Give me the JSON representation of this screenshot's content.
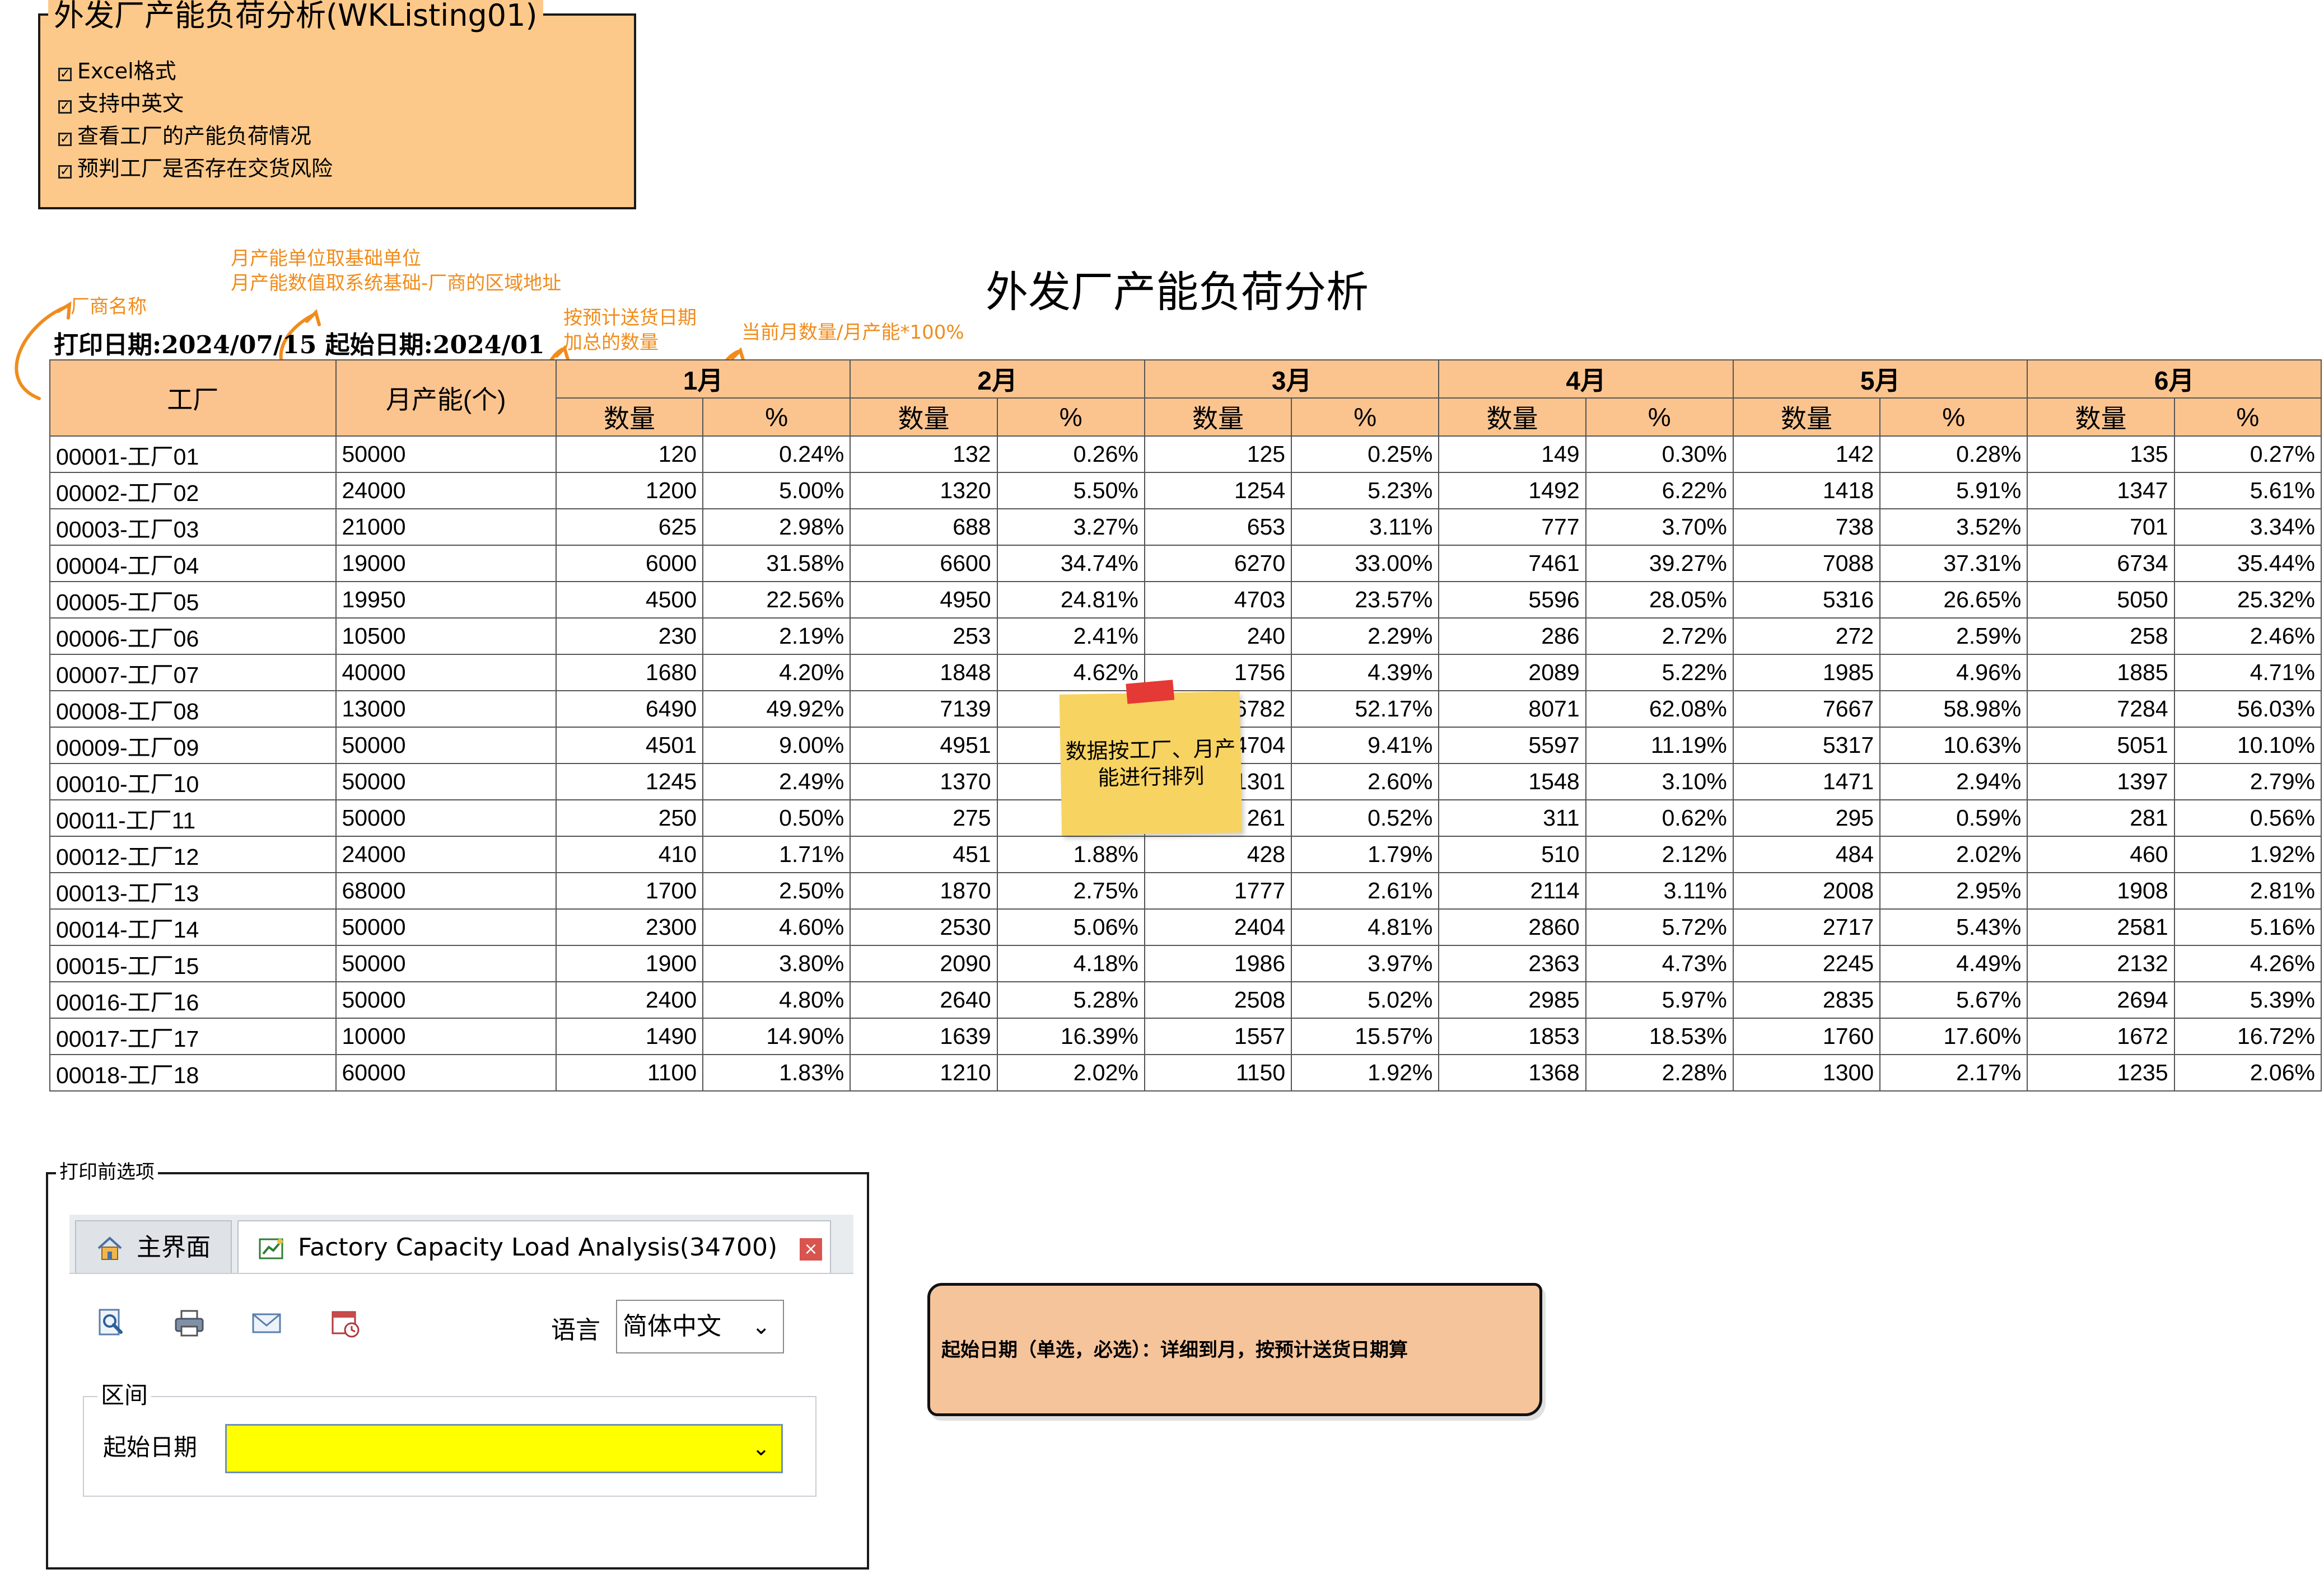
{
  "feature_box": {
    "title": "外发厂产能负荷分析(WKListing01)",
    "items": [
      "Excel格式",
      "支持中英文",
      "查看工厂的产能负荷情况",
      "预判工厂是否存在交货风险"
    ]
  },
  "annotations": {
    "vendor_name": "厂商名称",
    "capacity_unit": "月产能单位取基础单位",
    "capacity_value": "月产能数值取系统基础-厂商的区域地址",
    "qty_sum_1": "按预计送货日期",
    "qty_sum_2": "加总的数量",
    "percent_formula": "当前月数量/月产能*100%"
  },
  "report": {
    "title": "外发厂产能负荷分析",
    "print_date_label": "打印日期:",
    "print_date": "2024/07/15",
    "start_date_label": "起始日期:",
    "start_date": "2024/01"
  },
  "table": {
    "factory_header": "工厂",
    "capacity_header": "月产能(个)",
    "months": [
      "1月",
      "2月",
      "3月",
      "4月",
      "5月",
      "6月"
    ],
    "qty_header": "数量",
    "pct_header": "%",
    "rows": [
      {
        "factory": "00001-工厂01",
        "capacity": "50000",
        "cells": [
          [
            "120",
            "0.24%"
          ],
          [
            "132",
            "0.26%"
          ],
          [
            "125",
            "0.25%"
          ],
          [
            "149",
            "0.30%"
          ],
          [
            "142",
            "0.28%"
          ],
          [
            "135",
            "0.27%"
          ]
        ]
      },
      {
        "factory": "00002-工厂02",
        "capacity": "24000",
        "cells": [
          [
            "1200",
            "5.00%"
          ],
          [
            "1320",
            "5.50%"
          ],
          [
            "1254",
            "5.23%"
          ],
          [
            "1492",
            "6.22%"
          ],
          [
            "1418",
            "5.91%"
          ],
          [
            "1347",
            "5.61%"
          ]
        ]
      },
      {
        "factory": "00003-工厂03",
        "capacity": "21000",
        "cells": [
          [
            "625",
            "2.98%"
          ],
          [
            "688",
            "3.27%"
          ],
          [
            "653",
            "3.11%"
          ],
          [
            "777",
            "3.70%"
          ],
          [
            "738",
            "3.52%"
          ],
          [
            "701",
            "3.34%"
          ]
        ]
      },
      {
        "factory": "00004-工厂04",
        "capacity": "19000",
        "cells": [
          [
            "6000",
            "31.58%"
          ],
          [
            "6600",
            "34.74%"
          ],
          [
            "6270",
            "33.00%"
          ],
          [
            "7461",
            "39.27%"
          ],
          [
            "7088",
            "37.31%"
          ],
          [
            "6734",
            "35.44%"
          ]
        ]
      },
      {
        "factory": "00005-工厂05",
        "capacity": "19950",
        "cells": [
          [
            "4500",
            "22.56%"
          ],
          [
            "4950",
            "24.81%"
          ],
          [
            "4703",
            "23.57%"
          ],
          [
            "5596",
            "28.05%"
          ],
          [
            "5316",
            "26.65%"
          ],
          [
            "5050",
            "25.32%"
          ]
        ]
      },
      {
        "factory": "00006-工厂06",
        "capacity": "10500",
        "cells": [
          [
            "230",
            "2.19%"
          ],
          [
            "253",
            "2.41%"
          ],
          [
            "240",
            "2.29%"
          ],
          [
            "286",
            "2.72%"
          ],
          [
            "272",
            "2.59%"
          ],
          [
            "258",
            "2.46%"
          ]
        ]
      },
      {
        "factory": "00007-工厂07",
        "capacity": "40000",
        "cells": [
          [
            "1680",
            "4.20%"
          ],
          [
            "1848",
            "4.62%"
          ],
          [
            "1756",
            "4.39%"
          ],
          [
            "2089",
            "5.22%"
          ],
          [
            "1985",
            "4.96%"
          ],
          [
            "1885",
            "4.71%"
          ]
        ]
      },
      {
        "factory": "00008-工厂08",
        "capacity": "13000",
        "cells": [
          [
            "6490",
            "49.92%"
          ],
          [
            "7139",
            ""
          ],
          [
            "6782",
            "52.17%"
          ],
          [
            "8071",
            "62.08%"
          ],
          [
            "7667",
            "58.98%"
          ],
          [
            "7284",
            "56.03%"
          ]
        ]
      },
      {
        "factory": "00009-工厂09",
        "capacity": "50000",
        "cells": [
          [
            "4501",
            "9.00%"
          ],
          [
            "4951",
            ""
          ],
          [
            "4704",
            "9.41%"
          ],
          [
            "5597",
            "11.19%"
          ],
          [
            "5317",
            "10.63%"
          ],
          [
            "5051",
            "10.10%"
          ]
        ]
      },
      {
        "factory": "00010-工厂10",
        "capacity": "50000",
        "cells": [
          [
            "1245",
            "2.49%"
          ],
          [
            "1370",
            ""
          ],
          [
            "1301",
            "2.60%"
          ],
          [
            "1548",
            "3.10%"
          ],
          [
            "1471",
            "2.94%"
          ],
          [
            "1397",
            "2.79%"
          ]
        ]
      },
      {
        "factory": "00011-工厂11",
        "capacity": "50000",
        "cells": [
          [
            "250",
            "0.50%"
          ],
          [
            "275",
            ""
          ],
          [
            "261",
            "0.52%"
          ],
          [
            "311",
            "0.62%"
          ],
          [
            "295",
            "0.59%"
          ],
          [
            "281",
            "0.56%"
          ]
        ]
      },
      {
        "factory": "00012-工厂12",
        "capacity": "24000",
        "cells": [
          [
            "410",
            "1.71%"
          ],
          [
            "451",
            "1.88%"
          ],
          [
            "428",
            "1.79%"
          ],
          [
            "510",
            "2.12%"
          ],
          [
            "484",
            "2.02%"
          ],
          [
            "460",
            "1.92%"
          ]
        ]
      },
      {
        "factory": "00013-工厂13",
        "capacity": "68000",
        "cells": [
          [
            "1700",
            "2.50%"
          ],
          [
            "1870",
            "2.75%"
          ],
          [
            "1777",
            "2.61%"
          ],
          [
            "2114",
            "3.11%"
          ],
          [
            "2008",
            "2.95%"
          ],
          [
            "1908",
            "2.81%"
          ]
        ]
      },
      {
        "factory": "00014-工厂14",
        "capacity": "50000",
        "cells": [
          [
            "2300",
            "4.60%"
          ],
          [
            "2530",
            "5.06%"
          ],
          [
            "2404",
            "4.81%"
          ],
          [
            "2860",
            "5.72%"
          ],
          [
            "2717",
            "5.43%"
          ],
          [
            "2581",
            "5.16%"
          ]
        ]
      },
      {
        "factory": "00015-工厂15",
        "capacity": "50000",
        "cells": [
          [
            "1900",
            "3.80%"
          ],
          [
            "2090",
            "4.18%"
          ],
          [
            "1986",
            "3.97%"
          ],
          [
            "2363",
            "4.73%"
          ],
          [
            "2245",
            "4.49%"
          ],
          [
            "2132",
            "4.26%"
          ]
        ]
      },
      {
        "factory": "00016-工厂16",
        "capacity": "50000",
        "cells": [
          [
            "2400",
            "4.80%"
          ],
          [
            "2640",
            "5.28%"
          ],
          [
            "2508",
            "5.02%"
          ],
          [
            "2985",
            "5.97%"
          ],
          [
            "2835",
            "5.67%"
          ],
          [
            "2694",
            "5.39%"
          ]
        ]
      },
      {
        "factory": "00017-工厂17",
        "capacity": "10000",
        "cells": [
          [
            "1490",
            "14.90%"
          ],
          [
            "1639",
            "16.39%"
          ],
          [
            "1557",
            "15.57%"
          ],
          [
            "1853",
            "18.53%"
          ],
          [
            "1760",
            "17.60%"
          ],
          [
            "1672",
            "16.72%"
          ]
        ]
      },
      {
        "factory": "00018-工厂18",
        "capacity": "60000",
        "cells": [
          [
            "1100",
            "1.83%"
          ],
          [
            "1210",
            "2.02%"
          ],
          [
            "1150",
            "1.92%"
          ],
          [
            "1368",
            "2.28%"
          ],
          [
            "1300",
            "2.17%"
          ],
          [
            "1235",
            "2.06%"
          ]
        ]
      }
    ]
  },
  "sticky_note": {
    "text": "数据按工厂、月产能进行排列"
  },
  "options_panel": {
    "title": "打印前选项",
    "tab_main": "主界面",
    "tab_factory": "Factory Capacity Load Analysis(34700)",
    "close_icon": "×",
    "language_label": "语言",
    "language_value": "简体中文",
    "range_legend": "区间",
    "start_date_label": "起始日期",
    "start_date_value": ""
  },
  "callout": {
    "text": "起始日期（单选，必选）：详细到月，按预计送货日期算"
  },
  "colors": {
    "header_bg": "#fbc48f",
    "feature_bg": "#fdc98a",
    "annotation": "#f08c1c",
    "highlight": "#ffff00",
    "sticky": "#f7d362"
  }
}
